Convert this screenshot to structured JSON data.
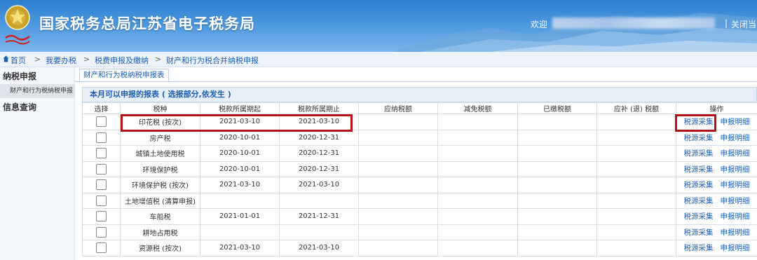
{
  "header": {
    "title": "国家税务总局江苏省电子税务局",
    "welcome": "欢迎",
    "separator": "|",
    "close_label": "关闭当"
  },
  "breadcrumb": [
    {
      "label": "首页"
    },
    {
      "label": "我要办税"
    },
    {
      "label": "税费申报及缴纳"
    },
    {
      "label": "财产和行为税合并纳税申报"
    }
  ],
  "breadcrumb_arrow": ">",
  "sidebar": {
    "group1": "纳税申报",
    "item1": "财产和行为税纳税申报",
    "group2": "信息查询"
  },
  "tab": {
    "label": "财产和行为税纳税申报表"
  },
  "panel": {
    "title": "本月可以申报的报表 ( 选报部分,依发生 )"
  },
  "table": {
    "headers": [
      "选择",
      "税种",
      "税款所属期起",
      "税款所属期止",
      "应纳税额",
      "减免税额",
      "已缴税额",
      "应补 (退) 税额",
      "操作"
    ],
    "rows": [
      {
        "tax": "印花税 (按次)",
        "start": "2021-03-10",
        "end": "2021-03-10"
      },
      {
        "tax": "房产税",
        "start": "2020-10-01",
        "end": "2020-12-31"
      },
      {
        "tax": "城镇土地使用税",
        "start": "2020-10-01",
        "end": "2020-12-31"
      },
      {
        "tax": "环境保护税",
        "start": "2020-10-01",
        "end": "2020-12-31"
      },
      {
        "tax": "环境保护税 (按次)",
        "start": "2021-03-10",
        "end": "2021-03-10"
      },
      {
        "tax": "土地增值税 (清算申报)",
        "start": "",
        "end": ""
      },
      {
        "tax": "车船税",
        "start": "2021-01-01",
        "end": "2021-12-31"
      },
      {
        "tax": "耕地占用税",
        "start": "",
        "end": ""
      },
      {
        "tax": "资源税 (按次)",
        "start": "2021-03-10",
        "end": "2021-03-10"
      }
    ],
    "action1": "税源采集",
    "action2": "申报明细"
  },
  "colors": {
    "link": "#1a5fb4",
    "highlight": "#b4121b",
    "banner": "#2f7fd0"
  }
}
